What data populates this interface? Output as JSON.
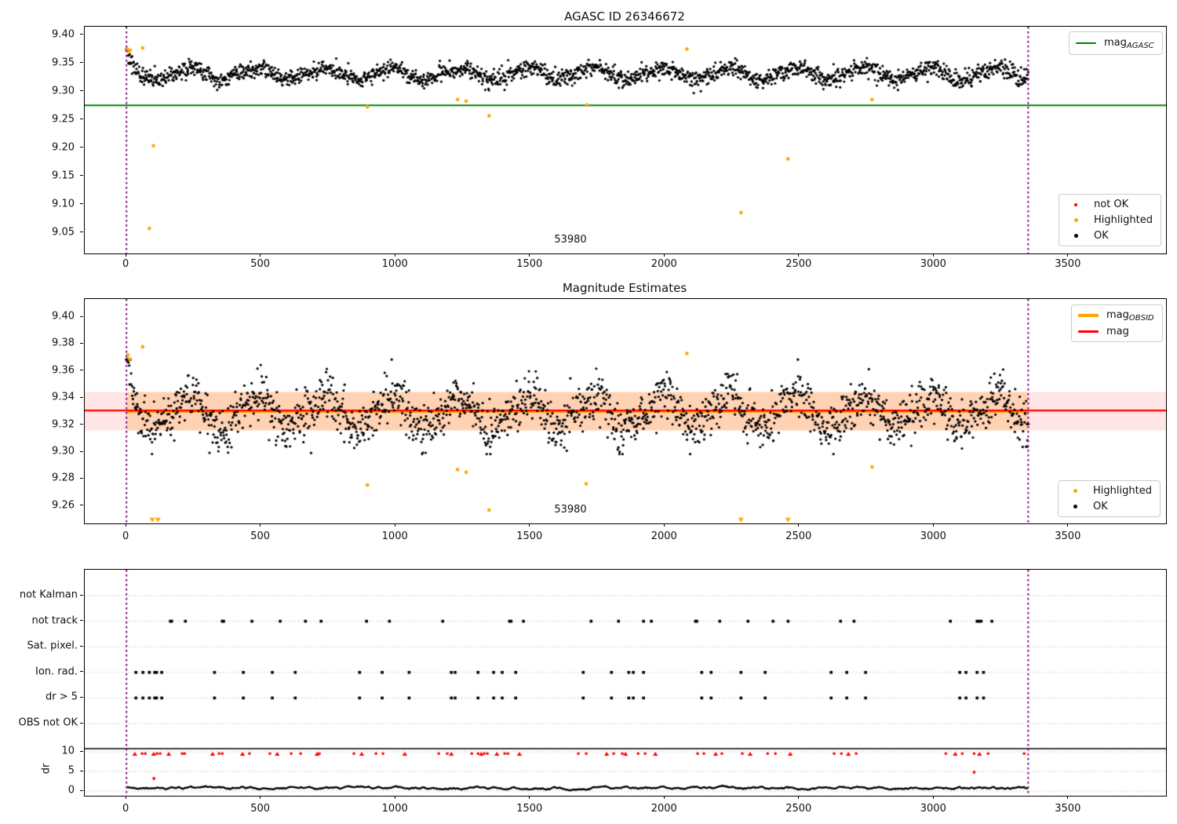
{
  "figure": {
    "kind": "matplotlib-figure"
  },
  "obsid": {
    "id_label": "53980",
    "x_start": 0,
    "x_end": 3350
  },
  "colors": {
    "ok_points": "#000000",
    "not_ok_points": "#ff0000",
    "highlighted_points": "#ffa500",
    "mag_agasc_line": "#008000",
    "mag_line": "#ff0000",
    "mag_obsid_line": "#ffa500",
    "obsid_vline": "#800080",
    "band_full": "rgba(255,0,0,0.10)",
    "band_obsid": "rgba(255,140,0,0.22)",
    "grid_dotted": "#aaaaaa",
    "axis": "#000000"
  },
  "xticks": [
    {
      "v": 0,
      "label": "0"
    },
    {
      "v": 500,
      "label": "500"
    },
    {
      "v": 1000,
      "label": "1000"
    },
    {
      "v": 1500,
      "label": "1500"
    },
    {
      "v": 2000,
      "label": "2000"
    },
    {
      "v": 2500,
      "label": "2500"
    },
    {
      "v": 3000,
      "label": "3000"
    },
    {
      "v": 3500,
      "label": "3500"
    }
  ],
  "chart_data": [
    {
      "id": "p1",
      "type": "scatter",
      "title": "AGASC ID 26346672",
      "xlim": [
        -155,
        3862
      ],
      "ylim": [
        9.0137,
        9.4146
      ],
      "yticks": [
        {
          "v": 9.05,
          "label": "9.05"
        },
        {
          "v": 9.1,
          "label": "9.10"
        },
        {
          "v": 9.15,
          "label": "9.15"
        },
        {
          "v": 9.2,
          "label": "9.20"
        },
        {
          "v": 9.25,
          "label": "9.25"
        },
        {
          "v": 9.3,
          "label": "9.30"
        },
        {
          "v": 9.35,
          "label": "9.35"
        },
        {
          "v": 9.4,
          "label": "9.40"
        }
      ],
      "hline_mag_agasc": {
        "y": 9.2755,
        "color": "#008000",
        "extent": "full-width"
      },
      "vlines": [
        0,
        3350
      ],
      "cloud": {
        "name": "OK",
        "n": 1950,
        "x0": 0,
        "x1": 3350,
        "mean": 9.3315,
        "amp": 0.0125,
        "period": 250,
        "rise_frac": 0.62,
        "phase": 0.62,
        "noise": 0.0075,
        "ymin": 9.2955,
        "ymax": 9.3745,
        "transient_amp": 0.038,
        "transient_tau": 16
      },
      "highlighted": [
        {
          "x": 3,
          "y": 9.375
        },
        {
          "x": 8,
          "y": 9.371
        },
        {
          "x": 14,
          "y": 9.373
        },
        {
          "x": 60,
          "y": 9.377
        },
        {
          "x": 85,
          "y": 9.058
        },
        {
          "x": 100,
          "y": 9.204
        },
        {
          "x": 895,
          "y": 9.273
        },
        {
          "x": 1230,
          "y": 9.286
        },
        {
          "x": 1262,
          "y": 9.283
        },
        {
          "x": 1347,
          "y": 9.257
        },
        {
          "x": 1711,
          "y": 9.276
        },
        {
          "x": 2082,
          "y": 9.375
        },
        {
          "x": 2283,
          "y": 9.086
        },
        {
          "x": 2458,
          "y": 9.181
        },
        {
          "x": 2770,
          "y": 9.286
        }
      ],
      "legend_top": [
        {
          "main": "mag",
          "sub": "AGASC",
          "color": "#008000",
          "marker": "line",
          "thickness": 2.5
        }
      ],
      "legend_bottom": [
        {
          "label": "not OK",
          "color": "#ff0000",
          "size": 4
        },
        {
          "label": "Highlighted",
          "color": "#ffa500",
          "size": 5
        },
        {
          "label": "OK",
          "color": "#000000",
          "size": 5
        }
      ],
      "annotation": {
        "text": "53980",
        "x": 1650,
        "y": 9.035
      }
    },
    {
      "id": "p2",
      "type": "scatter",
      "title": "Magnitude Estimates",
      "xlim": [
        -155,
        3862
      ],
      "ylim": [
        9.2471,
        9.4134
      ],
      "yticks": [
        {
          "v": 9.26,
          "label": "9.26"
        },
        {
          "v": 9.28,
          "label": "9.28"
        },
        {
          "v": 9.3,
          "label": "9.30"
        },
        {
          "v": 9.32,
          "label": "9.32"
        },
        {
          "v": 9.34,
          "label": "9.34"
        },
        {
          "v": 9.36,
          "label": "9.36"
        },
        {
          "v": 9.38,
          "label": "9.38"
        },
        {
          "v": 9.4,
          "label": "9.40"
        }
      ],
      "hline_mag": {
        "y": 9.3302,
        "color": "#ff0000",
        "extent": "full-width"
      },
      "hline_mag_obsid": {
        "y": 9.3302,
        "color": "#ffa500",
        "x0": 0,
        "x1": 3350
      },
      "band_full": {
        "ylow": 9.316,
        "yhigh": 9.3445
      },
      "band_obsid": {
        "ylow": 9.316,
        "yhigh": 9.3445,
        "x0": 0,
        "x1": 3350
      },
      "vlines": [
        0,
        3350
      ],
      "cloud": {
        "name": "OK",
        "n": 1850,
        "x0": 0,
        "x1": 3350,
        "mean": 9.3295,
        "amp": 0.0148,
        "period": 250,
        "rise_frac": 0.62,
        "phase": 0.62,
        "noise": 0.0088,
        "ymin": 9.2985,
        "ymax": 9.3685,
        "transient_amp": 0.042,
        "transient_tau": 15
      },
      "highlighted": [
        {
          "x": 5,
          "y": 9.372
        },
        {
          "x": 12,
          "y": 9.369
        },
        {
          "x": 60,
          "y": 9.378
        },
        {
          "x": 895,
          "y": 9.2755
        },
        {
          "x": 1230,
          "y": 9.287
        },
        {
          "x": 1262,
          "y": 9.285
        },
        {
          "x": 1347,
          "y": 9.257
        },
        {
          "x": 1708,
          "y": 9.2765
        },
        {
          "x": 2082,
          "y": 9.373
        },
        {
          "x": 2770,
          "y": 9.289
        }
      ],
      "highlighted_clipped_low_x": [
        96,
        117,
        2283,
        2458
      ],
      "legend_top": [
        {
          "main": "mag",
          "sub": "OBSID",
          "color": "#ffa500",
          "marker": "line",
          "thickness": 4
        },
        {
          "main": "mag",
          "sub": "",
          "color": "#ff0000",
          "marker": "line",
          "thickness": 2.5
        }
      ],
      "legend_bottom": [
        {
          "label": "Highlighted",
          "color": "#ffa500",
          "size": 5
        },
        {
          "label": "OK",
          "color": "#000000",
          "size": 5
        }
      ],
      "annotation": {
        "text": "53980",
        "x": 1650,
        "y": 9.255
      }
    },
    {
      "id": "p3",
      "type": "scatter",
      "title": "",
      "xlim": [
        -155,
        3862
      ],
      "ylabel": "dr",
      "rows": [
        "not Kalman",
        "not track",
        "Sat. pixel.",
        "Ion. rad.",
        "dr > 5",
        "OBS not OK"
      ],
      "dr_ticks": [
        {
          "v": 10,
          "label": "10"
        },
        {
          "v": 5,
          "label": "5"
        },
        {
          "v": 0,
          "label": "0"
        }
      ],
      "vlines": [
        0,
        3350
      ],
      "flags": {
        "not_kalman_x": [],
        "not_track_x": [
          163,
          168,
          219,
          356,
          361,
          466,
          571,
          665,
          723,
          892,
          977,
          1175,
          1423,
          1429,
          1475,
          1726,
          1828,
          1921,
          1950,
          2114,
          2119,
          2204,
          2309,
          2402,
          2458,
          2653,
          2703,
          3061,
          3160,
          3166,
          3175,
          3215
        ],
        "sat_pixel_x": [],
        "ion_rad_x": [
          35,
          61,
          85,
          105,
          112,
          131,
          327,
          434,
          542,
          627,
          866,
          950,
          1050,
          1207,
          1221,
          1306,
          1364,
          1396,
          1446,
          1697,
          1802,
          1866,
          1883,
          1921,
          2137,
          2172,
          2283,
          2373,
          2618,
          2676,
          2746,
          3096,
          3119,
          3160,
          3184
        ],
        "dr_gt5_x": [
          35,
          61,
          85,
          105,
          112,
          131,
          327,
          434,
          542,
          627,
          866,
          950,
          1050,
          1207,
          1221,
          1306,
          1364,
          1396,
          1446,
          1697,
          1802,
          1866,
          1883,
          1921,
          2137,
          2172,
          2283,
          2373,
          2618,
          2676,
          2746,
          3096,
          3119,
          3160,
          3184
        ],
        "obs_not_ok_x": []
      },
      "dr_red_clipped_at_10_x": [
        31,
        58,
        70,
        101,
        113,
        125,
        157,
        207,
        216,
        320,
        344,
        356,
        431,
        457,
        533,
        560,
        612,
        647,
        708,
        717,
        845,
        874,
        927,
        953,
        1034,
        1160,
        1192,
        1207,
        1283,
        1306,
        1318,
        1329,
        1341,
        1376,
        1405,
        1417,
        1460,
        1679,
        1708,
        1784,
        1810,
        1842,
        1854,
        1901,
        1927,
        1965,
        2122,
        2145,
        2189,
        2212,
        2288,
        2317,
        2382,
        2411,
        2466,
        2629,
        2656,
        2682,
        2711,
        3044,
        3079,
        3105,
        3149,
        3169,
        3201,
        3335
      ],
      "dr_red_points": [
        {
          "x": 102,
          "dr": 3.2
        },
        {
          "x": 3149,
          "dr": 4.8
        }
      ],
      "dr_trace": {
        "x0": 0,
        "x1": 3350,
        "step": 5,
        "base": 0.75,
        "walk": 0.5,
        "reversion": 0.8,
        "min": 0.15,
        "max": 1.95
      },
      "separator_line_dr": 10.8
    }
  ]
}
